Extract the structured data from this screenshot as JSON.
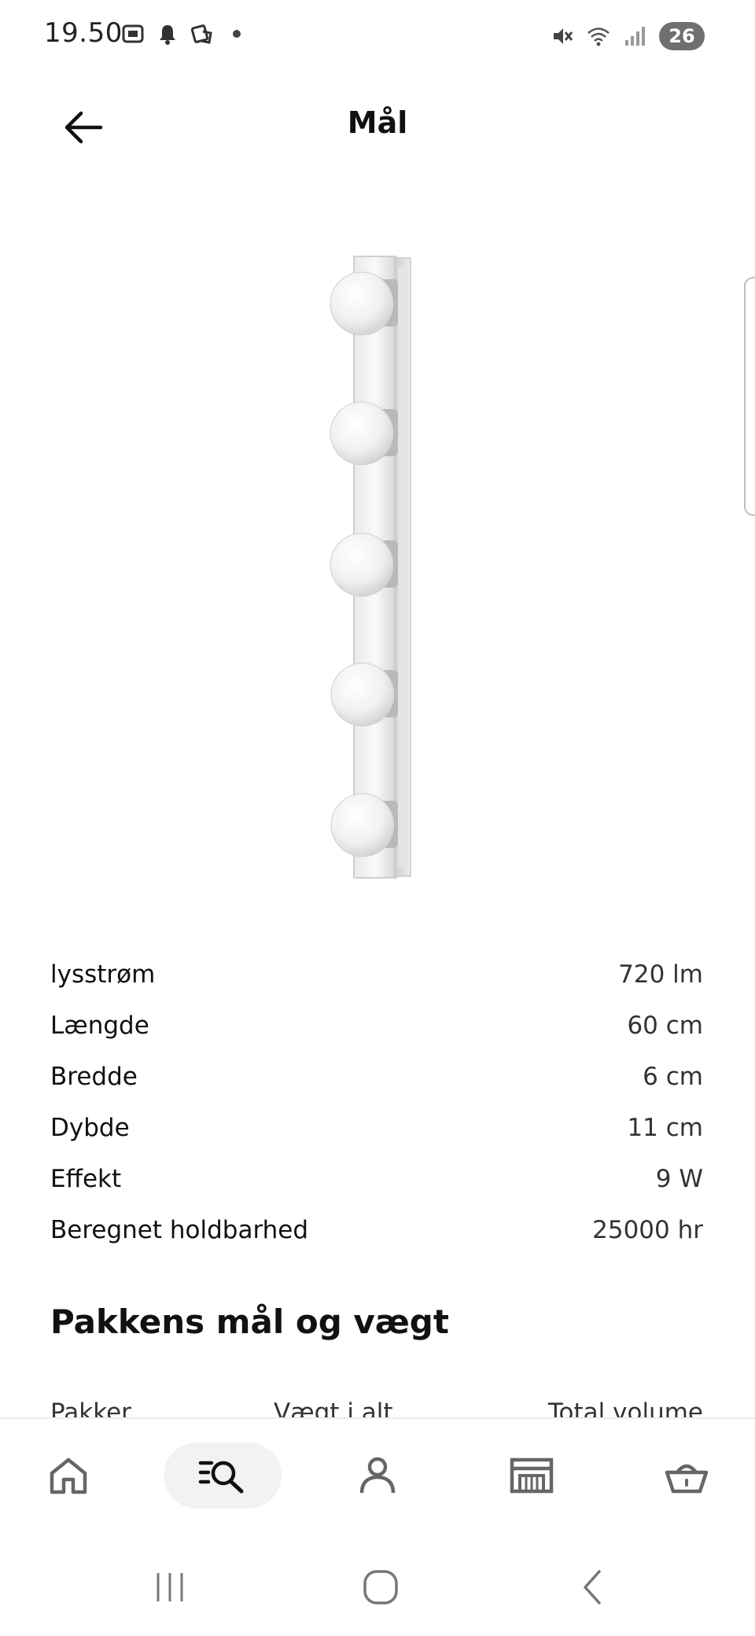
{
  "status_bar": {
    "time": "19.50",
    "battery": "26",
    "left_icons": [
      "screenshot-icon",
      "bell-icon",
      "cast-icon",
      "dot-icon"
    ],
    "right_icons": [
      "mute-icon",
      "wifi-icon",
      "signal-icon"
    ]
  },
  "header": {
    "title": "Mål",
    "back_icon": "arrow-left-icon"
  },
  "product": {
    "image_desc": "vanity-light-bar-icon",
    "bulbs": 5
  },
  "specs": [
    {
      "label": "lysstrøm",
      "value": "720 lm"
    },
    {
      "label": "Længde",
      "value": "60 cm"
    },
    {
      "label": "Bredde",
      "value": "6 cm"
    },
    {
      "label": "Dybde",
      "value": "11 cm"
    },
    {
      "label": "Effekt",
      "value": "9 W"
    },
    {
      "label": "Beregnet holdbarhed",
      "value": "25000 hr"
    }
  ],
  "package": {
    "title": "Pakkens mål og vægt",
    "headers": [
      "Pakker",
      "Vægt i alt",
      "Total volume"
    ]
  },
  "bottom_nav": {
    "items": [
      {
        "icon": "home-icon",
        "active": false
      },
      {
        "icon": "search-list-icon",
        "active": true
      },
      {
        "icon": "profile-icon",
        "active": false
      },
      {
        "icon": "store-icon",
        "active": false
      },
      {
        "icon": "basket-icon",
        "active": false
      }
    ]
  },
  "system_nav": {
    "items": [
      "recents-icon",
      "home-circle-icon",
      "back-chevron-icon"
    ]
  }
}
